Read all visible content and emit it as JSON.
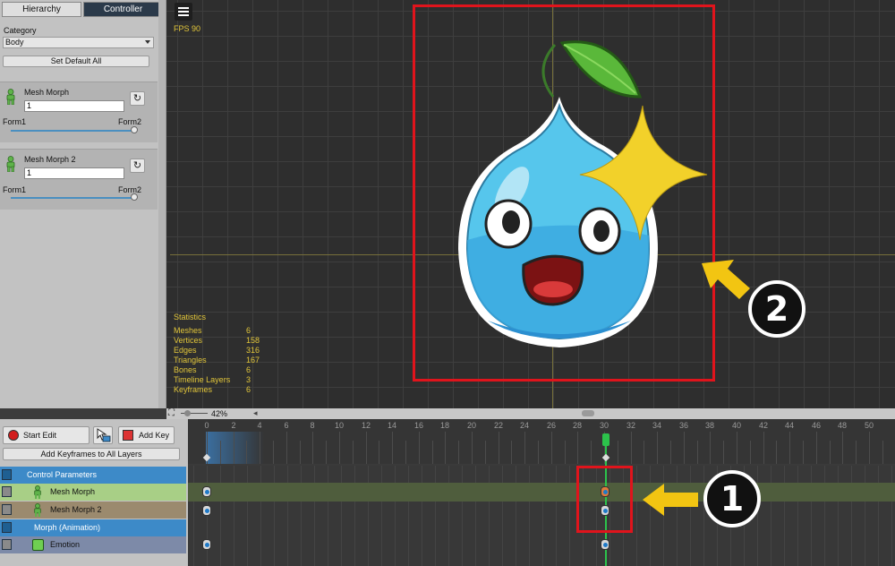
{
  "tabs": {
    "hierarchy": "Hierarchy",
    "controller": "Controller"
  },
  "category": {
    "label": "Category",
    "selected": "Body"
  },
  "set_default_all": "Set Default All",
  "params": [
    {
      "name": "Mesh Morph",
      "value": "1",
      "min_label": "Form1",
      "max_label": "Form2",
      "level": 1
    },
    {
      "name": "Mesh Morph 2",
      "value": "1",
      "min_label": "Form1",
      "max_label": "Form2",
      "level": 1
    }
  ],
  "viewport": {
    "fps": "FPS 90",
    "stats_title": "Statistics",
    "stats": [
      {
        "k": "Meshes",
        "v": "6"
      },
      {
        "k": "Vertices",
        "v": "158"
      },
      {
        "k": "Edges",
        "v": "316"
      },
      {
        "k": "Triangles",
        "v": "167"
      },
      {
        "k": "Bones",
        "v": "6"
      },
      {
        "k": "Timeline Layers",
        "v": "3"
      },
      {
        "k": "Keyframes",
        "v": "6"
      }
    ],
    "zoom": "42%"
  },
  "timeline": {
    "start_edit": "Start Edit",
    "add_key": "Add Key",
    "add_all": "Add Keyframes to All Layers",
    "ruler": [
      "0",
      "2",
      "4",
      "6",
      "8",
      "10",
      "12",
      "14",
      "16",
      "18",
      "20",
      "22",
      "24",
      "26",
      "28",
      "30",
      "32",
      "34",
      "36",
      "38",
      "40",
      "42",
      "44",
      "46",
      "48",
      "50"
    ],
    "layers": [
      {
        "name": "Control Parameters",
        "kind": "group",
        "color": "#3d8ac8"
      },
      {
        "name": "Mesh Morph",
        "kind": "param",
        "color": "#a8cf86"
      },
      {
        "name": "Mesh Morph 2",
        "kind": "param",
        "color": "#9b8a6e"
      },
      {
        "name": "Morph (Animation)",
        "kind": "group",
        "color": "#3d8ac8"
      },
      {
        "name": "Emotion",
        "kind": "mesh",
        "color": "#7d8aa8"
      }
    ],
    "current_frame": 30
  },
  "callouts": [
    "1",
    "2"
  ],
  "colors": {
    "highlight_red": "#e0141c",
    "arrow_yellow": "#f2c512",
    "accent_blue": "#3d8ac8"
  }
}
